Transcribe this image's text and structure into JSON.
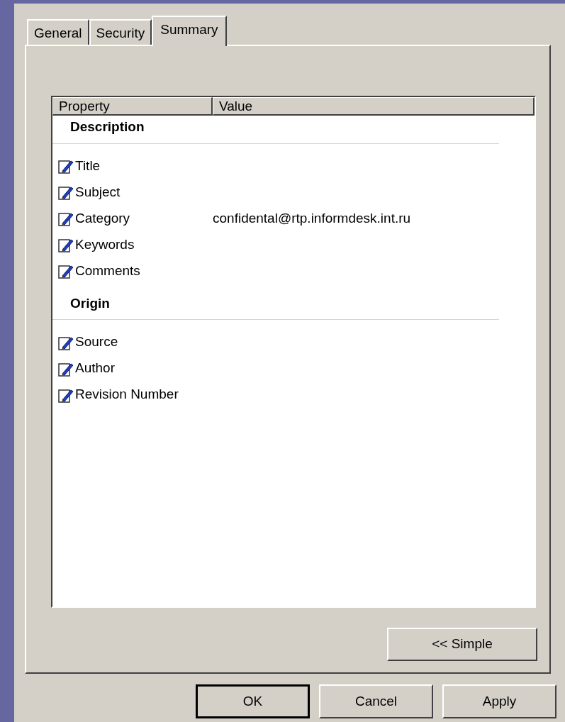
{
  "tabs": [
    {
      "label": "General",
      "selected": false
    },
    {
      "label": "Security",
      "selected": false
    },
    {
      "label": "Summary",
      "selected": true
    }
  ],
  "table": {
    "columns": [
      "Property",
      "Value"
    ],
    "groups": [
      {
        "heading": "Description",
        "rows": [
          {
            "property": "Title"
          },
          {
            "property": "Subject"
          },
          {
            "property": "Category",
            "value": "confidental@rtp.informdesk.int.ru"
          },
          {
            "property": "Keywords"
          },
          {
            "property": "Comments"
          }
        ]
      },
      {
        "heading": "Origin",
        "rows": [
          {
            "property": "Source"
          },
          {
            "property": "Author"
          },
          {
            "property": "Revision Number"
          }
        ]
      }
    ]
  },
  "toggle_button": "<< Simple",
  "buttons": [
    {
      "label": "OK",
      "default": true
    },
    {
      "label": "Cancel",
      "default": false
    },
    {
      "label": "Apply",
      "default": false
    }
  ]
}
